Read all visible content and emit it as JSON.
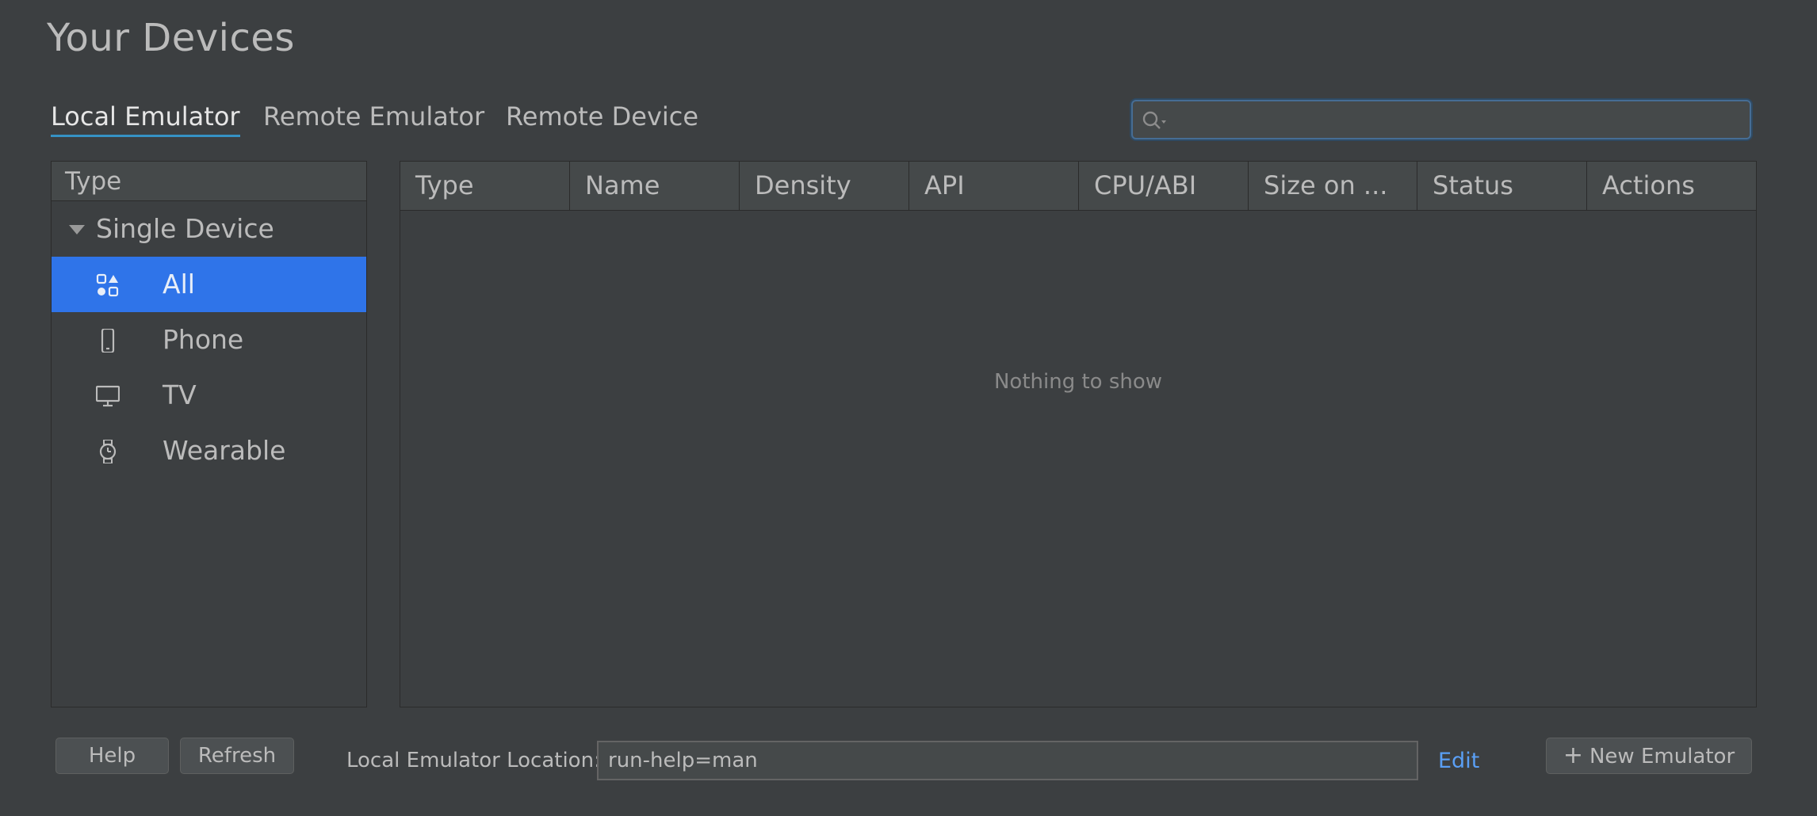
{
  "page": {
    "title": "Your Devices"
  },
  "tabs": [
    {
      "label": "Local Emulator",
      "active": true
    },
    {
      "label": "Remote Emulator",
      "active": false
    },
    {
      "label": "Remote Device",
      "active": false
    }
  ],
  "search": {
    "value": "",
    "placeholder": ""
  },
  "type_panel": {
    "header": "Type",
    "group": "Single Device",
    "items": [
      {
        "label": "All",
        "icon": "grid-shapes-icon",
        "selected": true
      },
      {
        "label": "Phone",
        "icon": "phone-icon",
        "selected": false
      },
      {
        "label": "TV",
        "icon": "tv-icon",
        "selected": false
      },
      {
        "label": "Wearable",
        "icon": "watch-icon",
        "selected": false
      }
    ]
  },
  "table": {
    "columns": [
      "Type",
      "Name",
      "Density",
      "API",
      "CPU/ABI",
      "Size on ...",
      "Status",
      "Actions"
    ],
    "rows": [],
    "empty_text": "Nothing to show"
  },
  "footer": {
    "help_label": "Help",
    "refresh_label": "Refresh",
    "location_label": "Local Emulator Location:",
    "location_value": "run-help=man",
    "edit_label": "Edit",
    "new_emulator_label": "New Emulator"
  },
  "colors": {
    "background": "#3c3f41",
    "selection": "#2f74e9",
    "link": "#5a9ff5",
    "tab_underline": "#3592c4"
  }
}
